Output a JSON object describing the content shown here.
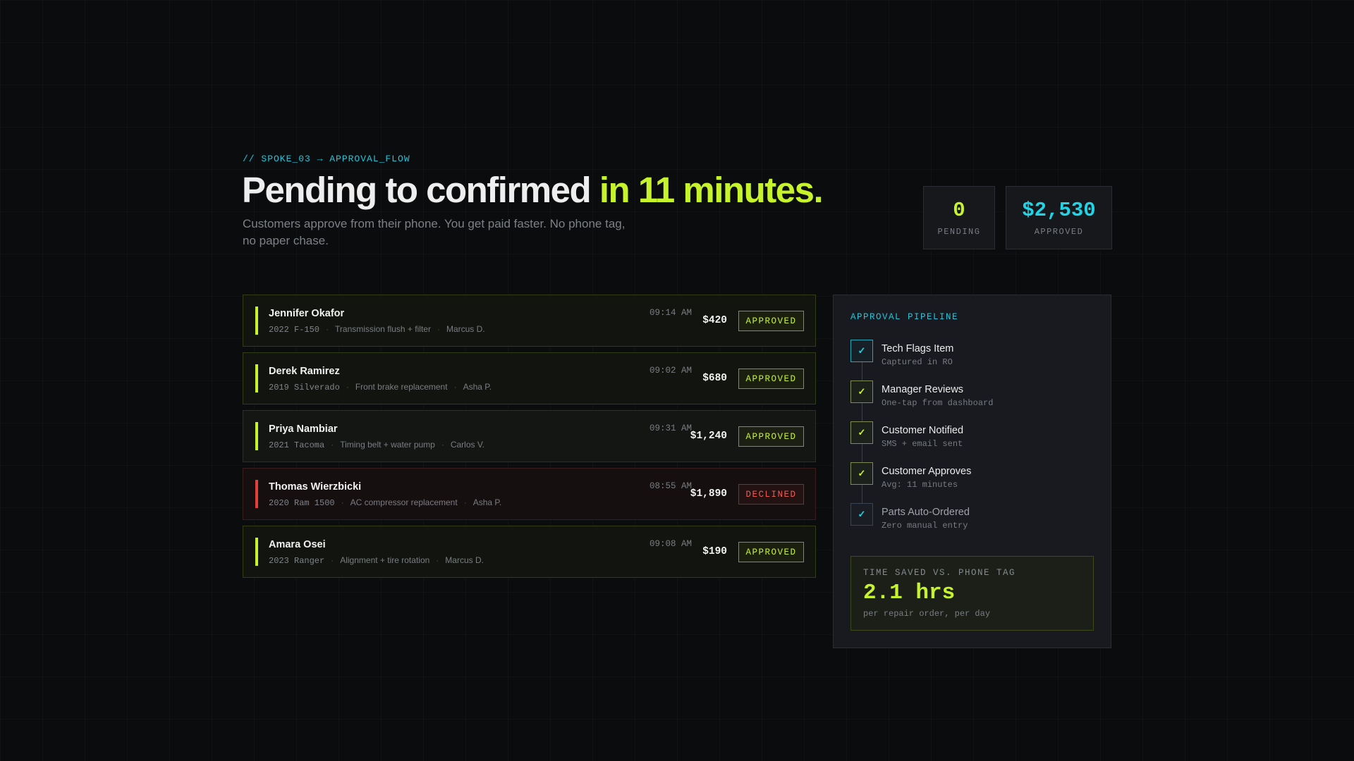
{
  "kicker": "// SPOKE_03 → APPROVAL_FLOW",
  "headline": {
    "main": "Pending to confirmed ",
    "accent": "in 11 minutes."
  },
  "subtitle": "Customers approve from their phone. You get paid faster. No phone tag, no paper chase.",
  "stats": {
    "pending": {
      "value": "0",
      "label": "PENDING"
    },
    "approved": {
      "value": "$2,530",
      "label": "APPROVED"
    }
  },
  "orders": [
    {
      "name": "Jennifer Okafor",
      "vehicle": "2022 F-150",
      "service": "Transmission flush + filter",
      "tech": "Marcus D.",
      "time": "09:14 AM",
      "amount": "$420",
      "status": "APPROVED"
    },
    {
      "name": "Derek Ramirez",
      "vehicle": "2019 Silverado",
      "service": "Front brake replacement",
      "tech": "Asha P.",
      "time": "09:02 AM",
      "amount": "$680",
      "status": "APPROVED"
    },
    {
      "name": "Priya Nambiar",
      "vehicle": "2021 Tacoma",
      "service": "Timing belt + water pump",
      "tech": "Carlos V.",
      "time": "09:31 AM",
      "amount": "$1,240",
      "status": "APPROVED"
    },
    {
      "name": "Thomas Wierzbicki",
      "vehicle": "2020 Ram 1500",
      "service": "AC compressor replacement",
      "tech": "Asha P.",
      "time": "08:55 AM",
      "amount": "$1,890",
      "status": "DECLINED"
    },
    {
      "name": "Amara Osei",
      "vehicle": "2023 Ranger",
      "service": "Alignment + tire rotation",
      "tech": "Marcus D.",
      "time": "09:08 AM",
      "amount": "$190",
      "status": "APPROVED"
    }
  ],
  "pipeline": {
    "title": "APPROVAL PIPELINE",
    "check": "✓",
    "steps": [
      {
        "title": "Tech Flags Item",
        "sub": "Captured in RO"
      },
      {
        "title": "Manager Reviews",
        "sub": "One-tap from dashboard"
      },
      {
        "title": "Customer Notified",
        "sub": "SMS + email sent"
      },
      {
        "title": "Customer Approves",
        "sub": "Avg: 11 minutes"
      },
      {
        "title": "Parts Auto-Ordered",
        "sub": "Zero manual entry"
      }
    ],
    "saved": {
      "label": "TIME SAVED VS. PHONE TAG",
      "value": "2.1 hrs",
      "sub": "per repair order, per day"
    }
  },
  "colors": {
    "accent_lime": "#c6f32b",
    "accent_cyan": "#22d3e6",
    "declined_red": "#e0413a",
    "background": "#0b0c0d"
  }
}
